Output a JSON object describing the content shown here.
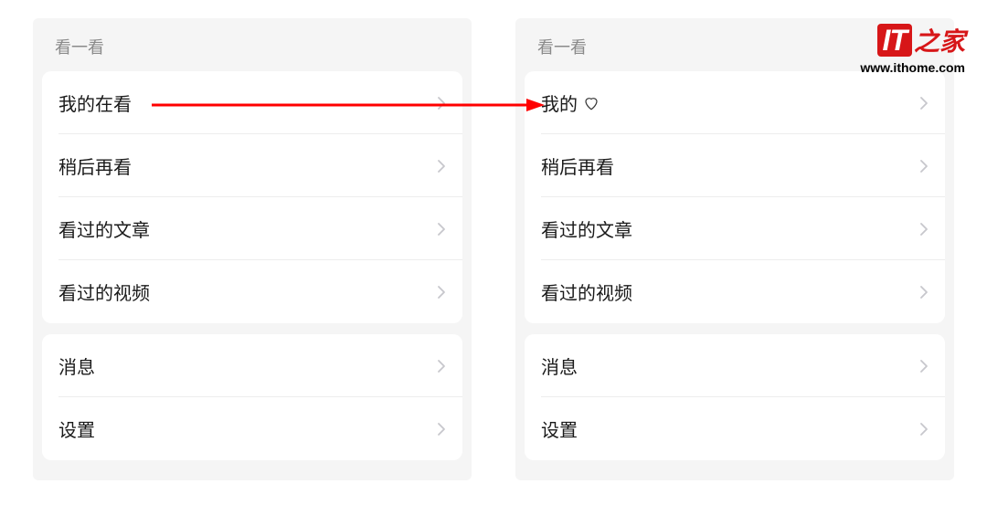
{
  "left_panel": {
    "title": "看一看",
    "group1": [
      {
        "label": "我的在看"
      },
      {
        "label": "稍后再看"
      },
      {
        "label": "看过的文章"
      },
      {
        "label": "看过的视频"
      }
    ],
    "group2": [
      {
        "label": "消息"
      },
      {
        "label": "设置"
      }
    ]
  },
  "right_panel": {
    "title": "看一看",
    "group1": [
      {
        "label": "我的",
        "has_heart": true
      },
      {
        "label": "稍后再看"
      },
      {
        "label": "看过的文章"
      },
      {
        "label": "看过的视频"
      }
    ],
    "group2": [
      {
        "label": "消息"
      },
      {
        "label": "设置"
      }
    ]
  },
  "watermark": {
    "brand_it": "IT",
    "brand_suffix": "之家",
    "url": "www.ithome.com"
  },
  "colors": {
    "arrow": "#ff0000",
    "brand": "#d71618"
  }
}
